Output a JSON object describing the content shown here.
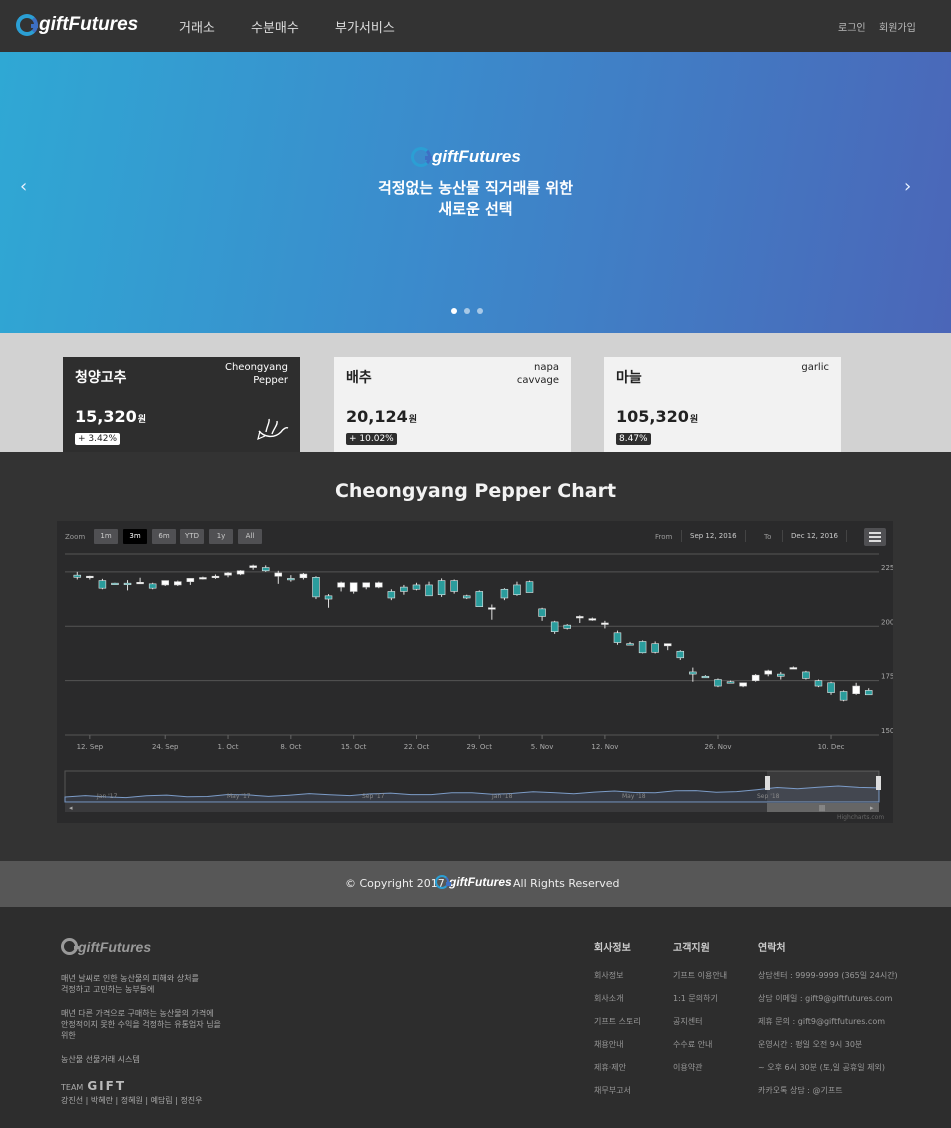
{
  "header": {
    "logo": "giftFutures",
    "nav": [
      "거래소",
      "수분매수",
      "부가서비스"
    ],
    "login": "로그인",
    "signup": "회원가입"
  },
  "hero": {
    "logo": "giftFutures",
    "line1": "걱정없는 농산물 직거래를 위한",
    "line2": "새로운 선택",
    "prev": "‹",
    "next": "›",
    "slide_count": 3,
    "active_slide": 1
  },
  "cards": [
    {
      "name_kr": "청양고추",
      "name_en": "Cheongyang\nPepper",
      "price": "15,320",
      "unit": "원",
      "change": "+ 3.42%"
    },
    {
      "name_kr": "배추",
      "name_en": "napa\ncavvage",
      "price": "20,124",
      "unit": "원",
      "change": "+ 10.02%"
    },
    {
      "name_kr": "마늘",
      "name_en": "garlic",
      "price": "105,320",
      "unit": "원",
      "change": "8.47%"
    }
  ],
  "chart": {
    "title": "Cheongyang Pepper Chart",
    "zoom_label": "Zoom",
    "zoom_buttons": [
      "1m",
      "3m",
      "6m",
      "YTD",
      "1y",
      "All"
    ],
    "zoom_active": "3m",
    "from_label": "From",
    "from_date": "Sep 12, 2016",
    "to_label": "To",
    "to_date": "Dec 12, 2016",
    "navigator_labels": [
      "Jan '17",
      "May '17",
      "Sep '17",
      "Jan '18",
      "May '18",
      "Sep '18"
    ],
    "credit": "Highcharts.com"
  },
  "chart_data": {
    "type": "candlestick",
    "xlabel": "",
    "ylabel": "",
    "ylim": [
      150,
      230
    ],
    "y_ticks": [
      150,
      175,
      200,
      225
    ],
    "x_ticks": [
      "12. Sep",
      "24. Sep",
      "1. Oct",
      "8. Oct",
      "15. Oct",
      "22. Oct",
      "29. Oct",
      "5. Nov",
      "12. Nov",
      "26. Nov",
      "10. Dec"
    ],
    "series": [
      {
        "values": [
          {
            "o": 223.5,
            "h": 225.0,
            "l": 221.5,
            "c": 222.5
          },
          {
            "o": 222.5,
            "h": 223.2,
            "l": 221.5,
            "c": 223.0
          },
          {
            "o": 221.0,
            "h": 221.8,
            "l": 217.0,
            "c": 217.5
          },
          {
            "o": 219.8,
            "h": 220.0,
            "l": 219.3,
            "c": 219.5
          },
          {
            "o": 219.8,
            "h": 221.2,
            "l": 216.5,
            "c": 219.6
          },
          {
            "o": 220.0,
            "h": 222.3,
            "l": 219.5,
            "c": 220.2
          },
          {
            "o": 219.5,
            "h": 220.0,
            "l": 217.0,
            "c": 217.5
          },
          {
            "o": 219.0,
            "h": 221.0,
            "l": 218.5,
            "c": 221.0
          },
          {
            "o": 219.0,
            "h": 221.0,
            "l": 218.5,
            "c": 220.5
          },
          {
            "o": 220.5,
            "h": 222.0,
            "l": 219.0,
            "c": 222.0
          },
          {
            "o": 222.0,
            "h": 222.8,
            "l": 221.5,
            "c": 222.4
          },
          {
            "o": 222.5,
            "h": 223.8,
            "l": 221.8,
            "c": 223.0
          },
          {
            "o": 223.5,
            "h": 224.9,
            "l": 222.5,
            "c": 224.5
          },
          {
            "o": 224.0,
            "h": 225.8,
            "l": 223.5,
            "c": 225.5
          },
          {
            "o": 227.0,
            "h": 228.3,
            "l": 226.0,
            "c": 227.8
          },
          {
            "o": 227.0,
            "h": 228.0,
            "l": 225.0,
            "c": 225.5
          },
          {
            "o": 223.0,
            "h": 225.5,
            "l": 219.5,
            "c": 224.5
          },
          {
            "o": 222.0,
            "h": 223.5,
            "l": 220.5,
            "c": 221.5
          },
          {
            "o": 222.3,
            "h": 224.5,
            "l": 221.5,
            "c": 224.0
          },
          {
            "o": 222.5,
            "h": 223.0,
            "l": 212.5,
            "c": 213.5
          },
          {
            "o": 214.0,
            "h": 214.8,
            "l": 208.5,
            "c": 212.5
          },
          {
            "o": 218.0,
            "h": 220.5,
            "l": 216.0,
            "c": 220.0
          },
          {
            "o": 216.0,
            "h": 220.0,
            "l": 215.0,
            "c": 220.0
          },
          {
            "o": 218.0,
            "h": 220.0,
            "l": 217.0,
            "c": 220.0
          },
          {
            "o": 218.0,
            "h": 220.5,
            "l": 217.5,
            "c": 220.0
          },
          {
            "o": 216.0,
            "h": 217.0,
            "l": 212.0,
            "c": 213.0
          },
          {
            "o": 218.0,
            "h": 219.0,
            "l": 214.5,
            "c": 216.0
          },
          {
            "o": 219.0,
            "h": 220.0,
            "l": 216.5,
            "c": 217.0
          },
          {
            "o": 219.0,
            "h": 220.5,
            "l": 214.0,
            "c": 214.0
          },
          {
            "o": 221.0,
            "h": 222.0,
            "l": 213.5,
            "c": 214.5
          },
          {
            "o": 221.0,
            "h": 221.5,
            "l": 215.0,
            "c": 216.0
          },
          {
            "o": 214.0,
            "h": 214.5,
            "l": 212.5,
            "c": 213.0
          },
          {
            "o": 216.0,
            "h": 216.5,
            "l": 210.5,
            "c": 209.0
          },
          {
            "o": 208.0,
            "h": 210.0,
            "l": 203.0,
            "c": 208.5
          },
          {
            "o": 217.0,
            "h": 217.5,
            "l": 212.0,
            "c": 213.0
          },
          {
            "o": 219.0,
            "h": 220.5,
            "l": 214.0,
            "c": 214.5
          },
          {
            "o": 220.5,
            "h": 221.0,
            "l": 215.5,
            "c": 215.5
          },
          {
            "o": 208.0,
            "h": 208.5,
            "l": 202.5,
            "c": 204.5
          },
          {
            "o": 202.0,
            "h": 202.5,
            "l": 196.5,
            "c": 197.5
          },
          {
            "o": 200.5,
            "h": 201.0,
            "l": 198.5,
            "c": 199.0
          },
          {
            "o": 204.0,
            "h": 205.0,
            "l": 201.5,
            "c": 204.5
          },
          {
            "o": 203.0,
            "h": 204.0,
            "l": 202.5,
            "c": 203.5
          },
          {
            "o": 201.5,
            "h": 202.5,
            "l": 199.0,
            "c": 201.5
          },
          {
            "o": 197.0,
            "h": 198.0,
            "l": 191.5,
            "c": 192.5
          },
          {
            "o": 192.0,
            "h": 192.8,
            "l": 191.5,
            "c": 191.5
          },
          {
            "o": 193.0,
            "h": 193.5,
            "l": 187.5,
            "c": 187.8
          },
          {
            "o": 192.0,
            "h": 193.0,
            "l": 187.5,
            "c": 188.0
          },
          {
            "o": 191.0,
            "h": 192.0,
            "l": 189.0,
            "c": 192.0
          },
          {
            "o": 188.5,
            "h": 189.0,
            "l": 184.5,
            "c": 185.5
          },
          {
            "o": 179.0,
            "h": 181.0,
            "l": 174.5,
            "c": 178.0
          },
          {
            "o": 177.0,
            "h": 177.5,
            "l": 176.5,
            "c": 176.5
          },
          {
            "o": 175.5,
            "h": 176.0,
            "l": 172.0,
            "c": 172.5
          },
          {
            "o": 174.5,
            "h": 175.0,
            "l": 173.8,
            "c": 174.2
          },
          {
            "o": 172.5,
            "h": 174.0,
            "l": 172.0,
            "c": 174.0
          },
          {
            "o": 175.0,
            "h": 178.0,
            "l": 174.5,
            "c": 177.5
          },
          {
            "o": 178.0,
            "h": 180.0,
            "l": 177.0,
            "c": 179.5
          },
          {
            "o": 178.0,
            "h": 179.0,
            "l": 175.5,
            "c": 177.0
          },
          {
            "o": 181.0,
            "h": 181.5,
            "l": 180.5,
            "c": 181.0
          },
          {
            "o": 179.0,
            "h": 179.5,
            "l": 175.5,
            "c": 176.0
          },
          {
            "o": 175.0,
            "h": 175.5,
            "l": 172.0,
            "c": 172.5
          },
          {
            "o": 174.0,
            "h": 174.5,
            "l": 168.5,
            "c": 169.5
          },
          {
            "o": 170.0,
            "h": 170.5,
            "l": 165.5,
            "c": 166.0
          },
          {
            "o": 169.0,
            "h": 174.0,
            "l": 168.5,
            "c": 172.5
          },
          {
            "o": 170.5,
            "h": 171.5,
            "l": 168.5,
            "c": 168.5
          }
        ]
      }
    ]
  },
  "copyright": {
    "before": "© Copyright 2017",
    "logo": "giftFutures",
    "after": "All Rights Reserved"
  },
  "footer": {
    "logo": "giftFutures",
    "desc1": "매년 날씨로 인한 농산물의 피해와 상처를\n걱정하고 고민하는 농부들에",
    "desc2": "매년 다른 가격으로 구매하는 농산물의 가격에\n 안정적이지 못한 수익을 걱정하는 유통업자 님을\n위한",
    "desc3": "농산물 선물거래 시스템",
    "team_label": "TEAM",
    "team_name": "GIFT",
    "members": "강진선 | 박혜란 | 정혜원 | 예담림 | 정진우",
    "col1_title": "회사정보",
    "col1": [
      "회사정보",
      "회사소개",
      "기프트 스토리",
      "채용안내",
      "제휴·제안",
      "채무부고서"
    ],
    "col2_title": "고객지원",
    "col2": [
      "기프트 이용안내",
      "1:1 문의하기",
      "공지센터",
      "수수료 안내",
      "이용약관"
    ],
    "col3_title": "연락처",
    "col3": [
      "상담센터 : 9999-9999 (365일 24시간)",
      "상담 이메일 : gift9@giftfutures.com",
      "제휴 문의 : gift9@giftfutures.com",
      "운영시간 : 평일 오전 9시 30분",
      "~ 오후 6시 30분 (토,일 공휴일 제외)",
      "카카오톡 상담 : @기프트"
    ]
  },
  "colors": {
    "brand_blue": "#2b9fd4",
    "up_candle": "#ffffff",
    "down_candle": "#2a9c9c"
  }
}
